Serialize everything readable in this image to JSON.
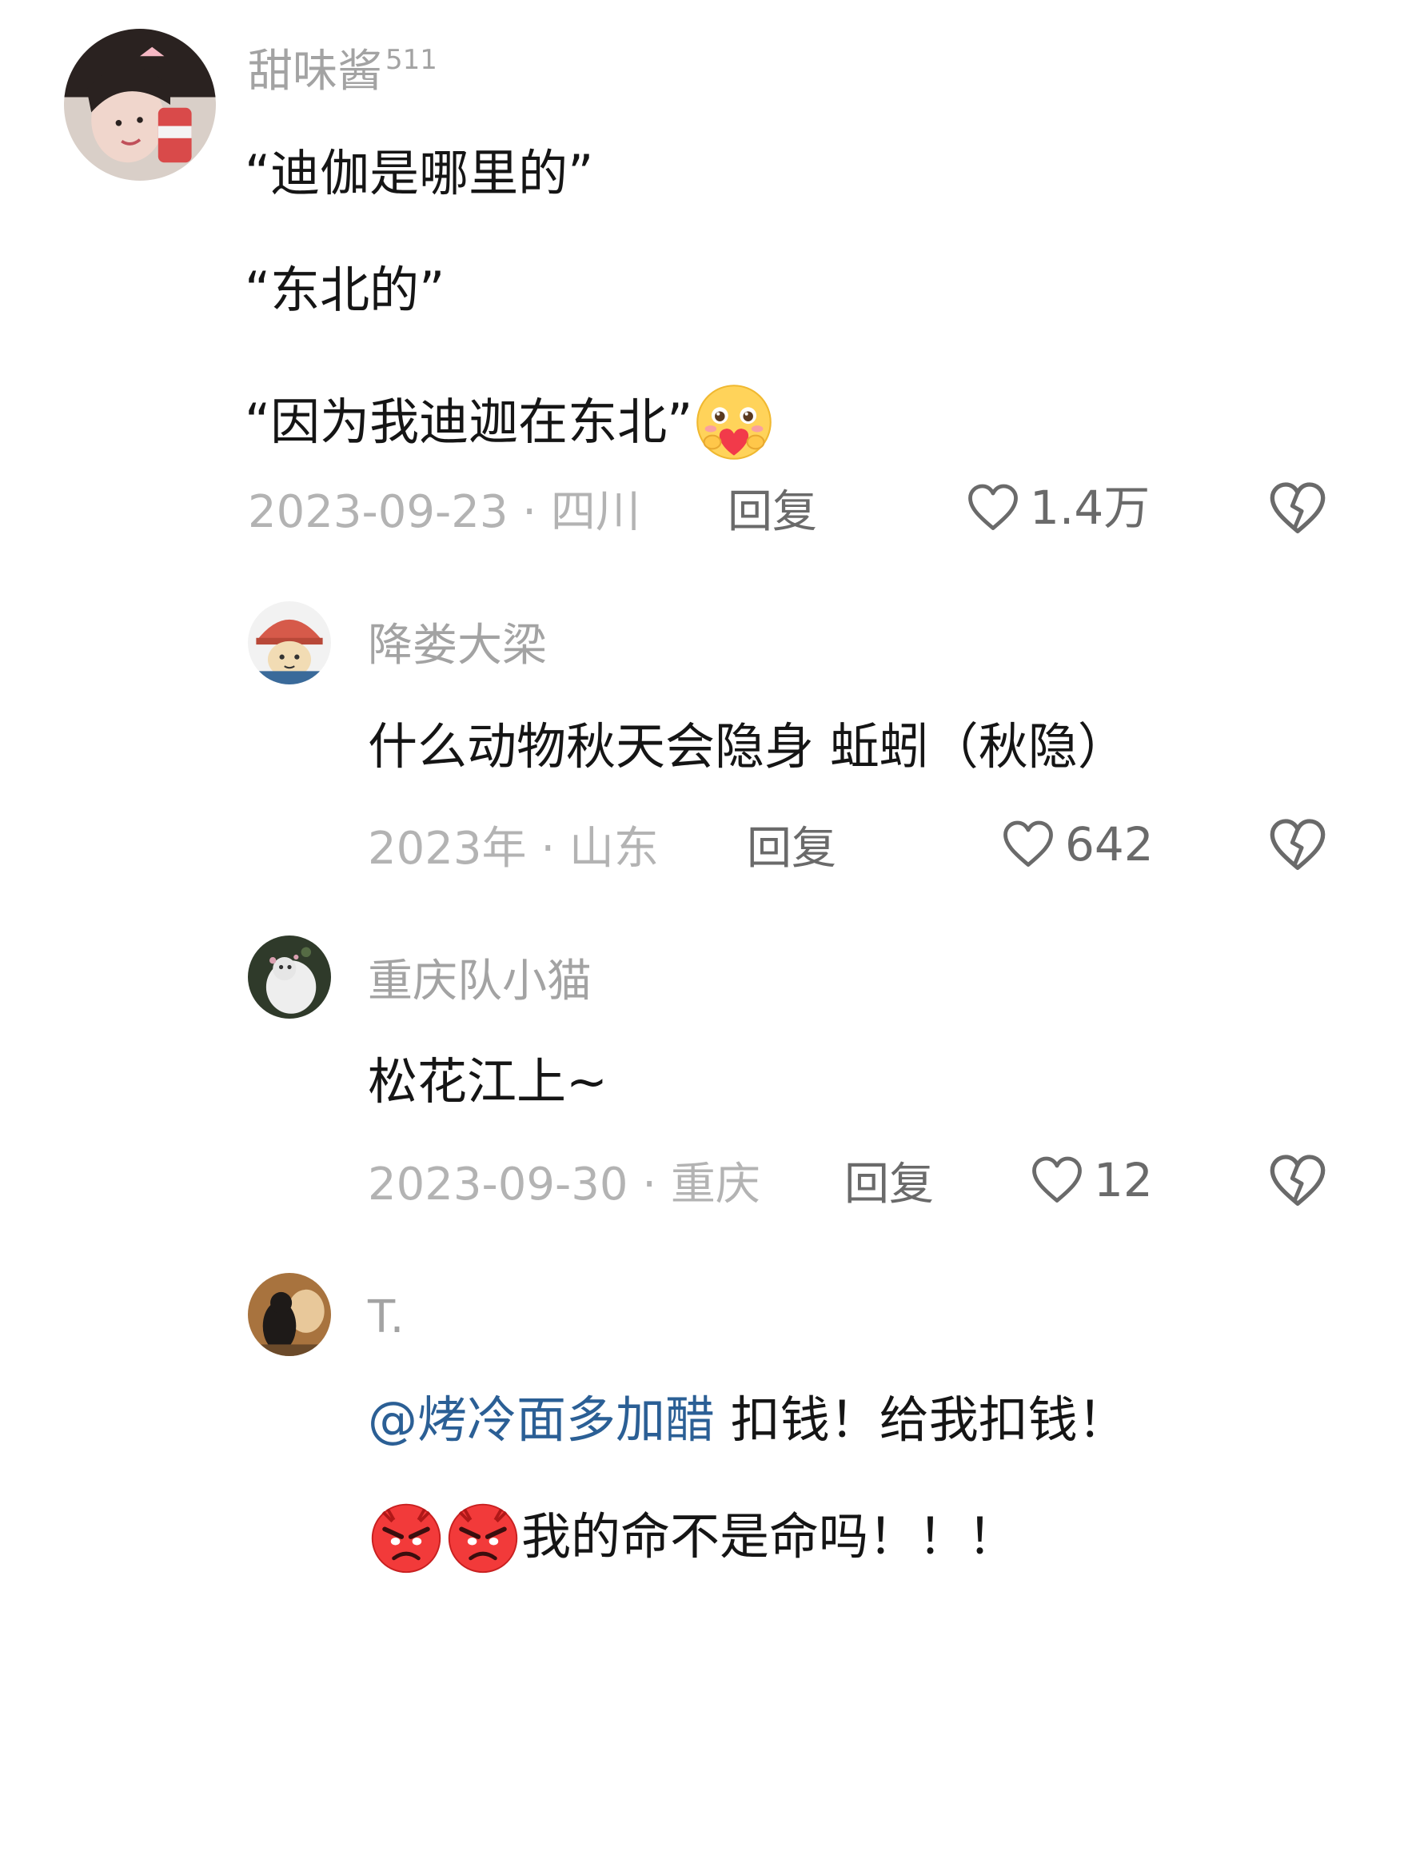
{
  "comments": [
    {
      "username": "甜味酱",
      "username_sup": "511",
      "lines": [
        "“迪伽是哪里的”",
        "“东北的”",
        "“因为我迪迦在东北”"
      ],
      "emoji_after_last_line": "shy-heart-emoji",
      "date_location": "2023-09-23 · 四川",
      "reply_label": "回复",
      "like_count": "1.4万"
    },
    {
      "username": "降娄大梁",
      "text": "什么动物秋天会隐身 蚯蚓（秋隐）",
      "date_location": "2023年 · 山东",
      "reply_label": "回复",
      "like_count": "642"
    },
    {
      "username": "重庆队小猫",
      "text": "松花江上~",
      "date_location": "2023-09-30 · 重庆",
      "reply_label": "回复",
      "like_count": "12"
    },
    {
      "username": "T.",
      "mention": "@烤冷面多加醋",
      "text_after_mention": " 扣钱！给我扣钱！",
      "emoji_line_prefix": [
        "angry-face-emoji",
        "angry-face-emoji"
      ],
      "text_line2": "我的命不是命吗！！！"
    }
  ],
  "icons": {
    "like": "heart-outline-icon",
    "dislike": "broken-heart-icon"
  },
  "colors": {
    "username": "#a3a3a3",
    "meta": "#b3b3b3",
    "reply": "#6a6a6a",
    "mention": "#2b5f95",
    "text": "#151515"
  }
}
